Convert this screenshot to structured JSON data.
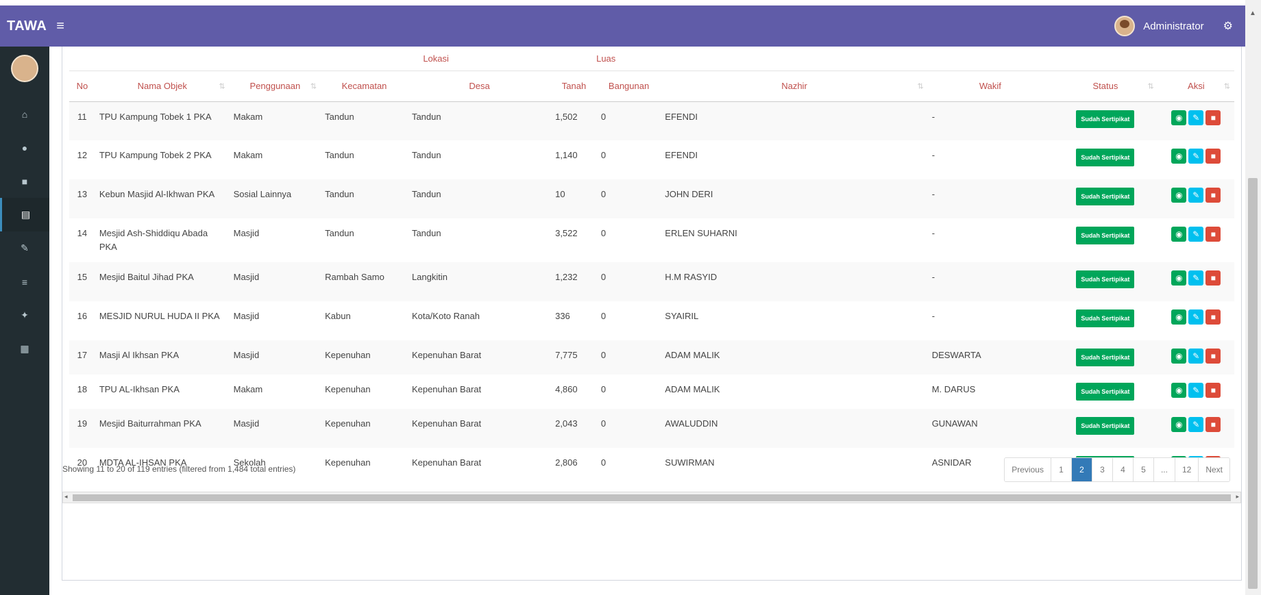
{
  "topbar": {
    "brand": "TAWA",
    "menu_icon": "hamburger-icon",
    "user_name": "Administrator",
    "settings_icon": "gears-icon"
  },
  "sidebar": {
    "items": [
      {
        "icon": "home-icon",
        "glyph": "⌂"
      },
      {
        "icon": "circle-icon",
        "glyph": "●"
      },
      {
        "icon": "folder-icon",
        "glyph": "■"
      },
      {
        "icon": "table-icon",
        "glyph": "▤",
        "active": true
      },
      {
        "icon": "edit-icon",
        "glyph": "✎"
      },
      {
        "icon": "list-icon",
        "glyph": "≡"
      },
      {
        "icon": "users-icon",
        "glyph": "✦"
      },
      {
        "icon": "grid-icon",
        "glyph": "▦"
      }
    ]
  },
  "table": {
    "group_headers": {
      "lokasi": "Lokasi",
      "luas": "Luas"
    },
    "headers": {
      "no": "No",
      "nama_objek": "Nama Objek",
      "penggunaan": "Penggunaan",
      "kecamatan": "Kecamatan",
      "desa": "Desa",
      "tanah": "Tanah",
      "bangunan": "Bangunan",
      "nazhir": "Nazhir",
      "wakif": "Wakif",
      "status": "Status",
      "aksi": "Aksi"
    },
    "rows": [
      {
        "no": "11",
        "nama": "TPU Kampung Tobek 1 PKA",
        "penggunaan": "Makam",
        "kecamatan": "Tandun",
        "desa": "Tandun",
        "tanah": "1,502",
        "bangunan": "0",
        "nazhir": "EFENDI",
        "wakif": "-",
        "status": "Sudah Sertipikat"
      },
      {
        "no": "12",
        "nama": "TPU Kampung Tobek 2 PKA",
        "penggunaan": "Makam",
        "kecamatan": "Tandun",
        "desa": "Tandun",
        "tanah": "1,140",
        "bangunan": "0",
        "nazhir": "EFENDI",
        "wakif": "-",
        "status": "Sudah Sertipikat"
      },
      {
        "no": "13",
        "nama": "Kebun Masjid Al-Ikhwan PKA",
        "penggunaan": "Sosial Lainnya",
        "kecamatan": "Tandun",
        "desa": "Tandun",
        "tanah": "10",
        "bangunan": "0",
        "nazhir": "JOHN DERI",
        "wakif": "-",
        "status": "Sudah Sertipikat"
      },
      {
        "no": "14",
        "nama": "Mesjid Ash-Shiddiqu Abada PKA",
        "penggunaan": "Masjid",
        "kecamatan": "Tandun",
        "desa": "Tandun",
        "tanah": "3,522",
        "bangunan": "0",
        "nazhir": "ERLEN SUHARNI",
        "wakif": "-",
        "status": "Sudah Sertipikat"
      },
      {
        "no": "15",
        "nama": "Mesjid Baitul Jihad PKA",
        "penggunaan": "Masjid",
        "kecamatan": "Rambah Samo",
        "desa": "Langkitin",
        "tanah": "1,232",
        "bangunan": "0",
        "nazhir": "H.M RASYID",
        "wakif": "-",
        "status": "Sudah Sertipikat"
      },
      {
        "no": "16",
        "nama": "MESJID NURUL HUDA II PKA",
        "penggunaan": "Masjid",
        "kecamatan": "Kabun",
        "desa": "Kota/Koto Ranah",
        "tanah": "336",
        "bangunan": "0",
        "nazhir": "SYAIRIL",
        "wakif": "-",
        "status": "Sudah Sertipikat"
      },
      {
        "no": "17",
        "nama": "Masji Al Ikhsan PKA",
        "penggunaan": "Masjid",
        "kecamatan": "Kepenuhan",
        "desa": "Kepenuhan Barat",
        "tanah": "7,775",
        "bangunan": "0",
        "nazhir": "ADAM MALIK",
        "wakif": "DESWARTA",
        "status": "Sudah Sertipikat"
      },
      {
        "no": "18",
        "nama": "TPU AL-Ikhsan PKA",
        "penggunaan": "Makam",
        "kecamatan": "Kepenuhan",
        "desa": "Kepenuhan Barat",
        "tanah": "4,860",
        "bangunan": "0",
        "nazhir": "ADAM MALIK",
        "wakif": "M. DARUS",
        "status": "Sudah Sertipikat"
      },
      {
        "no": "19",
        "nama": "Mesjid Baiturrahman PKA",
        "penggunaan": "Masjid",
        "kecamatan": "Kepenuhan",
        "desa": "Kepenuhan Barat",
        "tanah": "2,043",
        "bangunan": "0",
        "nazhir": "AWALUDDIN",
        "wakif": "GUNAWAN",
        "status": "Sudah Sertipikat"
      },
      {
        "no": "20",
        "nama": "MDTA AL-IHSAN PKA",
        "penggunaan": "Sekolah",
        "kecamatan": "Kepenuhan",
        "desa": "Kepenuhan Barat",
        "tanah": "2,806",
        "bangunan": "0",
        "nazhir": "SUWIRMAN",
        "wakif": "ASNIDAR",
        "status": "Sudah Sertipikat"
      }
    ]
  },
  "footer": {
    "info": "Showing 11 to 20 of 119 entries (filtered from 1,484 total entries)",
    "pagination": [
      "Previous",
      "1",
      "2",
      "3",
      "4",
      "5",
      "...",
      "12",
      "Next"
    ],
    "active_page": "2"
  },
  "colors": {
    "topbar": "#605ca8",
    "sidebar": "#222d32",
    "header_text": "#c0504d",
    "badge": "#00a65a",
    "view": "#00a65a",
    "edit": "#00c0ef",
    "delete": "#dd4b39"
  }
}
